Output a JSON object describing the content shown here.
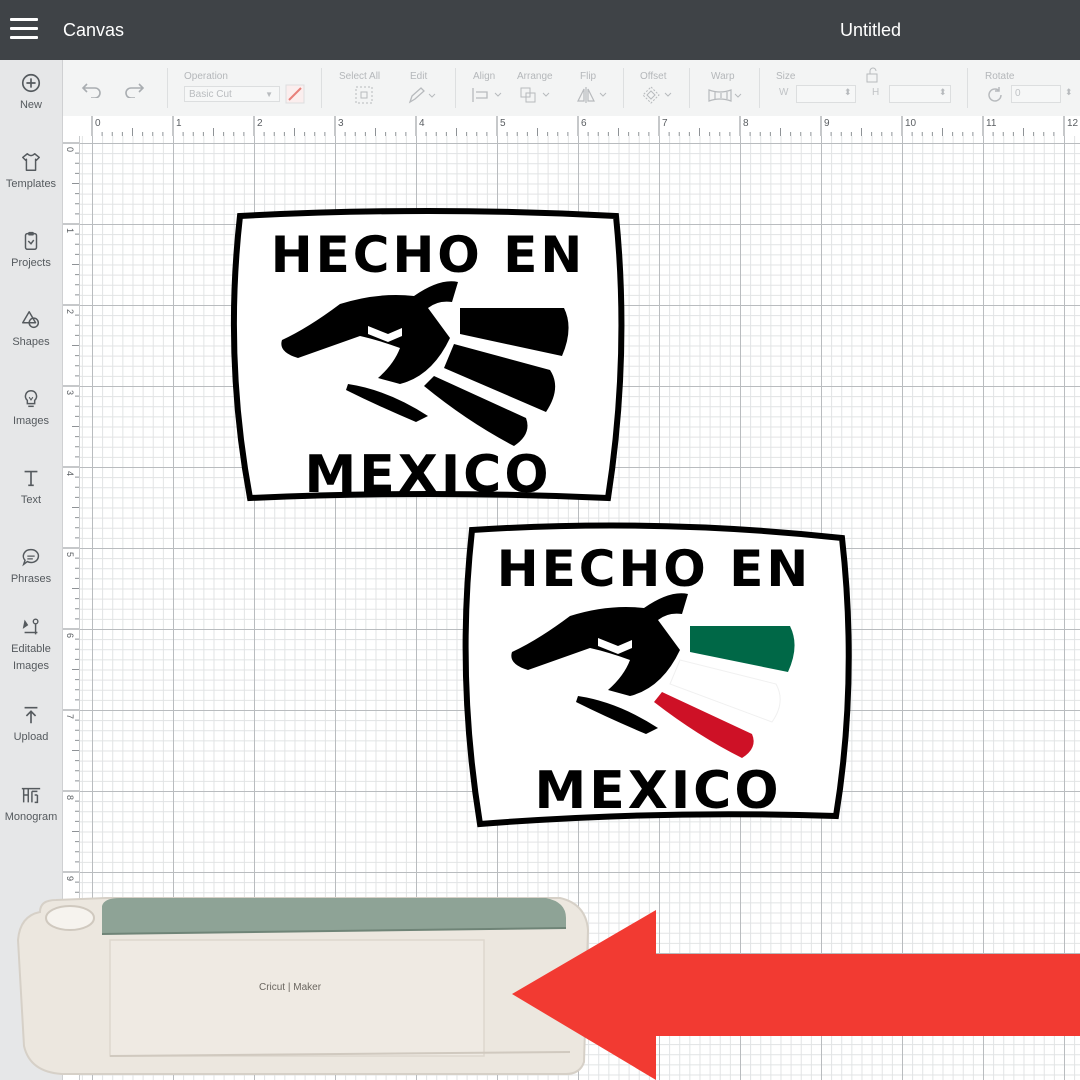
{
  "topbar": {
    "app_title": "Canvas",
    "doc_title": "Untitled"
  },
  "sidebar": {
    "items": [
      {
        "label": "New",
        "icon": "plus-circle-icon"
      },
      {
        "label": "Templates",
        "icon": "tshirt-icon"
      },
      {
        "label": "Projects",
        "icon": "project-icon"
      },
      {
        "label": "Shapes",
        "icon": "shapes-icon"
      },
      {
        "label": "Images",
        "icon": "lightbulb-icon"
      },
      {
        "label": "Text",
        "icon": "text-icon"
      },
      {
        "label": "Phrases",
        "icon": "speech-bubble-icon"
      },
      {
        "label": "Editable Images",
        "icon": "editable-image-icon"
      },
      {
        "label": "Upload",
        "icon": "upload-icon"
      },
      {
        "label": "Monogram",
        "icon": "monogram-icon"
      }
    ]
  },
  "toolbar": {
    "operation_label": "Operation",
    "operation_value": "Basic Cut",
    "select_all_label": "Select All",
    "edit_label": "Edit",
    "align_label": "Align",
    "arrange_label": "Arrange",
    "flip_label": "Flip",
    "offset_label": "Offset",
    "warp_label": "Warp",
    "size_label": "Size",
    "width_label": "W",
    "height_label": "H",
    "rotate_label": "Rotate",
    "rotate_value": "0"
  },
  "ruler": {
    "top": [
      "0",
      "1",
      "2",
      "3",
      "4",
      "5",
      "6",
      "7",
      "8",
      "9",
      "10",
      "11",
      "12"
    ],
    "left": [
      "0",
      "1",
      "2",
      "3",
      "4",
      "5",
      "6",
      "7",
      "8",
      "9"
    ]
  },
  "designs": [
    {
      "line1": "HECHO EN",
      "line2": "MEXICO",
      "variant": "black"
    },
    {
      "line1": "HECHO EN",
      "line2": "MEXICO",
      "variant": "flag"
    }
  ],
  "colors": {
    "topbar": "#3f4347",
    "flag_green": "#006847",
    "flag_white": "#ffffff",
    "flag_red": "#ce1126",
    "arrow": "#f23a32",
    "machine_body": "#ece7df",
    "machine_lid": "#8ea396"
  },
  "machine": {
    "brand": "Cricut",
    "model": "Maker"
  }
}
